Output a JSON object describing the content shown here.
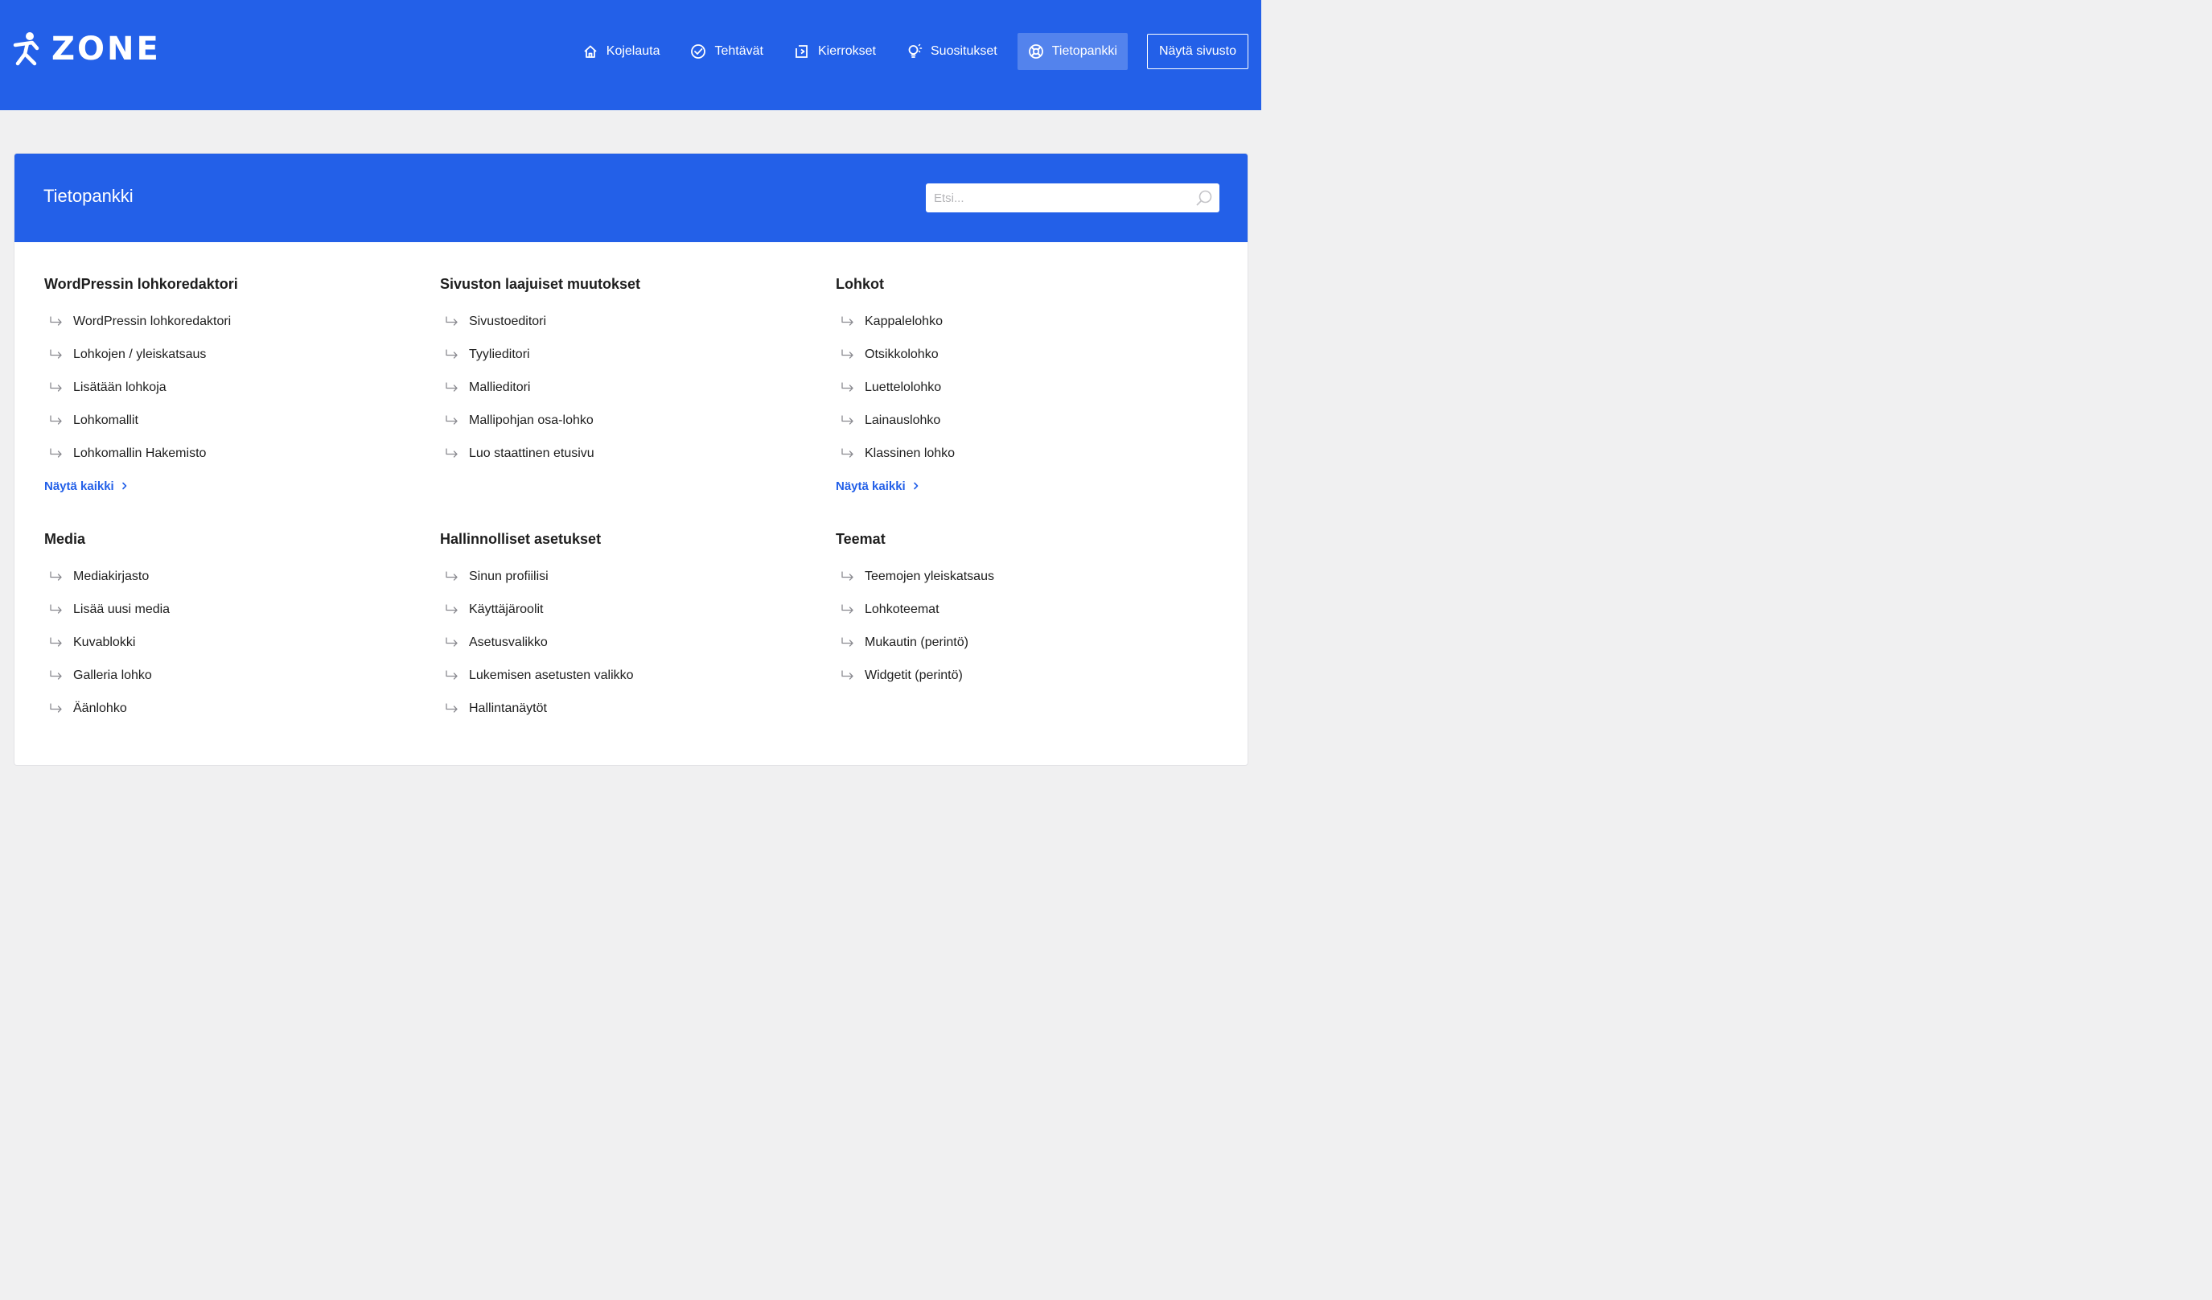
{
  "brand": {
    "logo_text": "ZONE"
  },
  "nav": {
    "items": [
      {
        "label": "Kojelauta",
        "icon": "home-icon"
      },
      {
        "label": "Tehtävät",
        "icon": "check-circle-icon"
      },
      {
        "label": "Kierrokset",
        "icon": "play-square-icon"
      },
      {
        "label": "Suositukset",
        "icon": "lightbulb-icon"
      },
      {
        "label": "Tietopankki",
        "icon": "lifebuoy-icon",
        "active": true
      }
    ],
    "view_site_label": "Näytä sivusto"
  },
  "page": {
    "title": "Tietopankki",
    "search_placeholder": "Etsi..."
  },
  "sections": [
    {
      "title": "WordPressin lohkoredaktori",
      "items": [
        "WordPressin lohkoredaktori",
        "Lohkojen / yleiskatsaus",
        "Lisätään lohkoja",
        "Lohkomallit",
        "Lohkomallin Hakemisto"
      ],
      "show_all": "Näytä kaikki"
    },
    {
      "title": "Sivuston laajuiset muutokset",
      "items": [
        "Sivustoeditori",
        "Tyylieditori",
        "Mallieditori",
        "Mallipohjan osa-lohko",
        "Luo staattinen etusivu"
      ],
      "show_all": ""
    },
    {
      "title": "Lohkot",
      "items": [
        "Kappalelohko",
        "Otsikkolohko",
        "Luettelolohko",
        "Lainauslohko",
        "Klassinen lohko"
      ],
      "show_all": "Näytä kaikki"
    },
    {
      "title": "Media",
      "items": [
        "Mediakirjasto",
        "Lisää uusi media",
        "Kuvablokki",
        "Galleria lohko",
        "Äänlohko"
      ],
      "show_all": ""
    },
    {
      "title": "Hallinnolliset asetukset",
      "items": [
        "Sinun profiilisi",
        "Käyttäjäroolit",
        "Asetusvalikko",
        "Lukemisen asetusten valikko",
        "Hallintanäytöt"
      ],
      "show_all": ""
    },
    {
      "title": "Teemat",
      "items": [
        "Teemojen yleiskatsaus",
        "Lohkoteemat",
        "Mukautin (perintö)",
        "Widgetit (perintö)"
      ],
      "show_all": ""
    }
  ],
  "colors": {
    "accent": "#2360e8",
    "background": "#f0f0f1"
  }
}
